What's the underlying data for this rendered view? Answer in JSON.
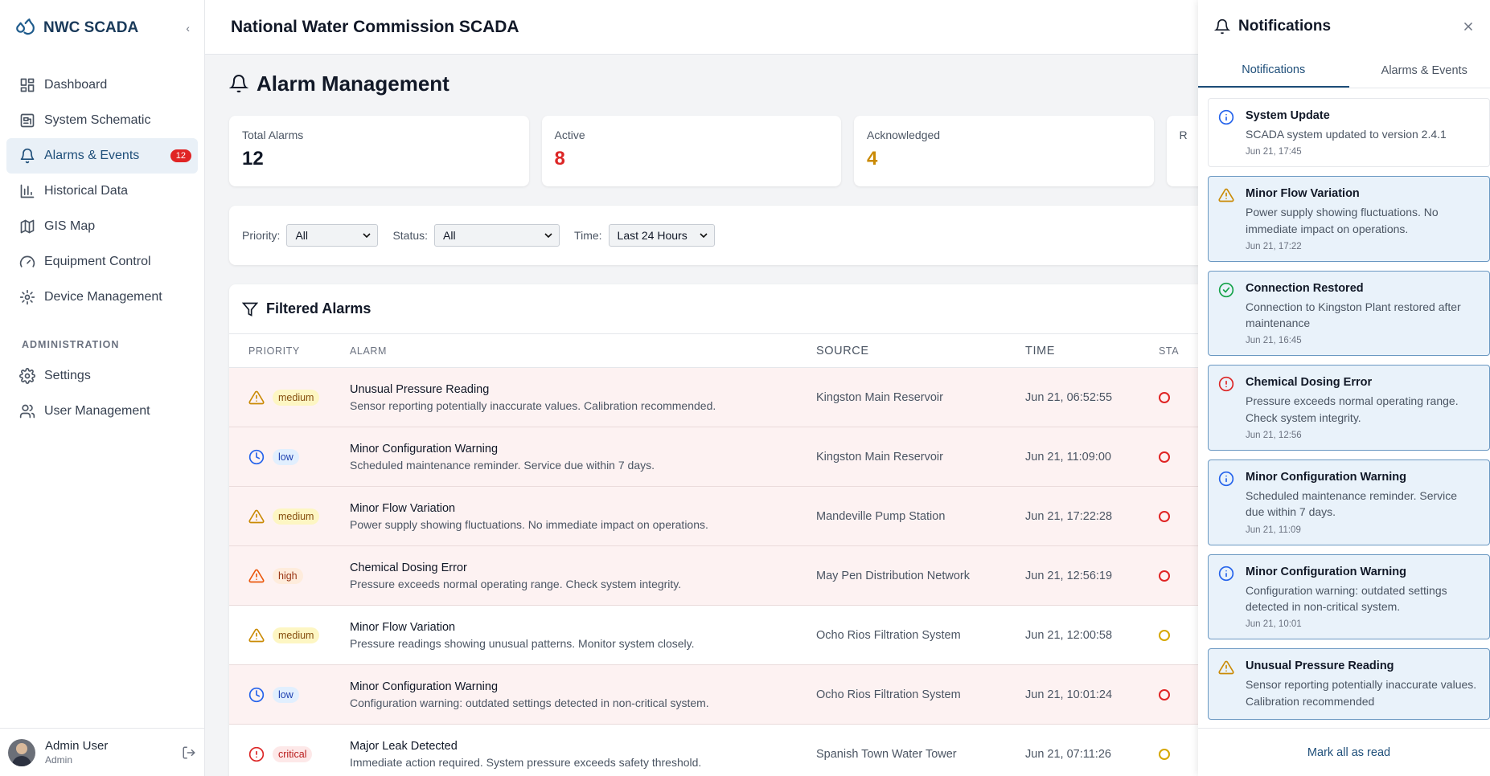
{
  "app": {
    "brand": "NWC SCADA",
    "header_title": "National Water Commission SCADA"
  },
  "colors": {
    "brand": "#1e5b8c",
    "active_nav_bg": "#e9f0f7",
    "alarm_row_bg": "#fdf2f2",
    "unread_bg": "#e9f2fa"
  },
  "sidebar": {
    "items": [
      {
        "label": "Dashboard",
        "icon": "dashboard-icon"
      },
      {
        "label": "System Schematic",
        "icon": "schematic-icon"
      },
      {
        "label": "Alarms & Events",
        "icon": "bell-icon",
        "badge": "12",
        "active": true
      },
      {
        "label": "Historical Data",
        "icon": "bar-chart-icon"
      },
      {
        "label": "GIS Map",
        "icon": "map-icon"
      },
      {
        "label": "Equipment Control",
        "icon": "gauge-icon"
      },
      {
        "label": "Device Management",
        "icon": "cog-icon"
      }
    ],
    "admin_label": "ADMINISTRATION",
    "admin_items": [
      {
        "label": "Settings",
        "icon": "gear-icon"
      },
      {
        "label": "User Management",
        "icon": "users-icon"
      }
    ],
    "user": {
      "name": "Admin User",
      "role": "Admin"
    }
  },
  "page": {
    "title": "Alarm Management"
  },
  "stats": [
    {
      "label": "Total Alarms",
      "value": "12",
      "color": "#111827"
    },
    {
      "label": "Active",
      "value": "8",
      "color": "#dc2626"
    },
    {
      "label": "Acknowledged",
      "value": "4",
      "color": "#ca8a04"
    },
    {
      "label": "R",
      "value": "",
      "color": "#16a34a"
    }
  ],
  "filters": {
    "priority_label": "Priority:",
    "priority_value": "All",
    "status_label": "Status:",
    "status_value": "All",
    "time_label": "Time:",
    "time_value": "Last 24 Hours"
  },
  "table": {
    "title": "Filtered Alarms",
    "headers": [
      "PRIORITY",
      "ALARM",
      "SOURCE",
      "TIME",
      "STA"
    ],
    "rows": [
      {
        "priority": "medium",
        "name": "Unusual Pressure Reading",
        "desc": "Sensor reporting potentially inaccurate values. Calibration recommended.",
        "source": "Kingston Main Reservoir",
        "time": "Jun 21, 06:52:55",
        "status": "red"
      },
      {
        "priority": "low",
        "name": "Minor Configuration Warning",
        "desc": "Scheduled maintenance reminder. Service due within 7 days.",
        "source": "Kingston Main Reservoir",
        "time": "Jun 21, 11:09:00",
        "status": "red"
      },
      {
        "priority": "medium",
        "name": "Minor Flow Variation",
        "desc": "Power supply showing fluctuations. No immediate impact on operations.",
        "source": "Mandeville Pump Station",
        "time": "Jun 21, 17:22:28",
        "status": "red"
      },
      {
        "priority": "high",
        "name": "Chemical Dosing Error",
        "desc": "Pressure exceeds normal operating range. Check system integrity.",
        "source": "May Pen Distribution Network",
        "time": "Jun 21, 12:56:19",
        "status": "red"
      },
      {
        "priority": "medium",
        "name": "Minor Flow Variation",
        "desc": "Pressure readings showing unusual patterns. Monitor system closely.",
        "source": "Ocho Rios Filtration System",
        "time": "Jun 21, 12:00:58",
        "status": "amber",
        "white": true
      },
      {
        "priority": "low",
        "name": "Minor Configuration Warning",
        "desc": "Configuration warning: outdated settings detected in non-critical system.",
        "source": "Ocho Rios Filtration System",
        "time": "Jun 21, 10:01:24",
        "status": "red"
      },
      {
        "priority": "critical",
        "name": "Major Leak Detected",
        "desc": "Immediate action required. System pressure exceeds safety threshold.",
        "source": "Spanish Town Water Tower",
        "time": "Jun 21, 07:11:26",
        "status": "amber",
        "white": true
      }
    ]
  },
  "notifications": {
    "title": "Notifications",
    "tabs": [
      "Notifications",
      "Alarms & Events"
    ],
    "items": [
      {
        "type": "info",
        "title": "System Update",
        "text": "SCADA system updated to version 2.4.1",
        "time": "Jun 21, 17:45",
        "unread": false
      },
      {
        "type": "warning",
        "title": "Minor Flow Variation",
        "text": "Power supply showing fluctuations. No immediate impact on operations.",
        "time": "Jun 21, 17:22",
        "unread": true
      },
      {
        "type": "success",
        "title": "Connection Restored",
        "text": "Connection to Kingston Plant restored after maintenance",
        "time": "Jun 21, 16:45",
        "unread": true
      },
      {
        "type": "error",
        "title": "Chemical Dosing Error",
        "text": "Pressure exceeds normal operating range. Check system integrity.",
        "time": "Jun 21, 12:56",
        "unread": true
      },
      {
        "type": "info",
        "title": "Minor Configuration Warning",
        "text": "Scheduled maintenance reminder. Service due within 7 days.",
        "time": "Jun 21, 11:09",
        "unread": true
      },
      {
        "type": "info",
        "title": "Minor Configuration Warning",
        "text": "Configuration warning: outdated settings detected in non-critical system.",
        "time": "Jun 21, 10:01",
        "unread": true
      },
      {
        "type": "warning",
        "title": "Unusual Pressure Reading",
        "text": "Sensor reporting potentially inaccurate values. Calibration recommended",
        "time": "",
        "unread": true
      }
    ],
    "mark_all": "Mark all as read"
  }
}
